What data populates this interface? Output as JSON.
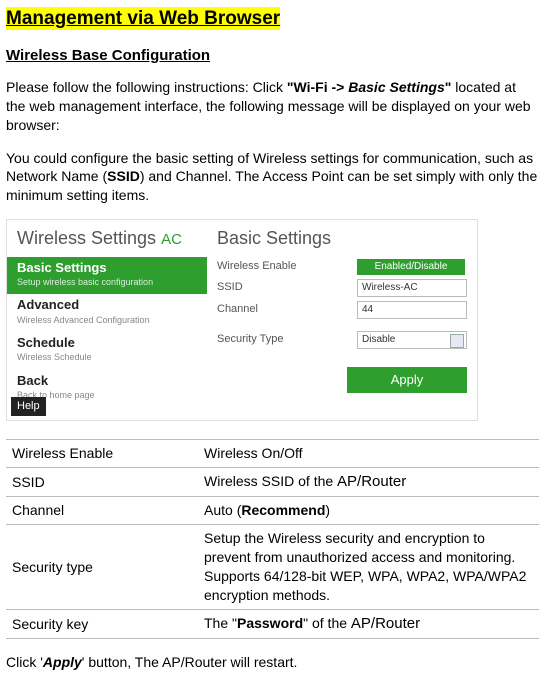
{
  "title": "Management via Web Browser",
  "subheader": "Wireless Base Configuration",
  "para1_a": "Please follow the following instructions: Click ",
  "para1_b": "\"Wi-Fi -> ",
  "para1_c": "Basic Settings",
  "para1_d": "\"",
  "para1_e": " located at the web management interface, the following message will be displayed on your web browser:",
  "para2_a": "You could configure the basic setting of Wireless settings for communication, such as Network Name (",
  "para2_b": "SSID",
  "para2_c": ") and Channel. The Access Point can be set simply with only the minimum setting items.",
  "mock": {
    "left_title": "Wireless Settings",
    "left_title_suffix": "AC",
    "items": [
      {
        "title": "Basic Settings",
        "sub": "Setup wireless basic configuration",
        "active": true
      },
      {
        "title": "Advanced",
        "sub": "Wireless Advanced Configuration",
        "active": false
      },
      {
        "title": "Schedule",
        "sub": "Wireless Schedule",
        "active": false
      },
      {
        "title": "Back",
        "sub": "Back to home page",
        "active": false
      }
    ],
    "help": "Help",
    "right_title": "Basic Settings",
    "form": {
      "wireless_enable_label": "Wireless Enable",
      "wireless_enable_value": "Enabled/Disable",
      "ssid_label": "SSID",
      "ssid_value": "Wireless-AC",
      "channel_label": "Channel",
      "channel_value": "44",
      "security_type_label": "Security Type",
      "security_type_value": "Disable",
      "apply": "Apply"
    }
  },
  "table": {
    "rows": [
      {
        "k": "Wireless Enable",
        "v_plain": "Wireless On/Off"
      },
      {
        "k": "SSID",
        "v_a": "Wireless SSID of the ",
        "v_b": "AP/Router"
      },
      {
        "k": "Channel",
        "v_a": "Auto (",
        "v_b": "Recommend",
        "v_c": ")"
      },
      {
        "k": "Security type",
        "v_plain": "Setup the Wireless security and encryption to prevent from unauthorized access and monitoring.\nSupports 64/128-bit WEP, WPA, WPA2, WPA/WPA2 encryption methods."
      },
      {
        "k": "Security key",
        "v_a": "The \"",
        "v_b": "Password",
        "v_c": "\" of the ",
        "v_d": "AP/Router"
      }
    ]
  },
  "footer_a": "Click '",
  "footer_b": "Apply",
  "footer_c": "' button, The AP/Router will restart."
}
